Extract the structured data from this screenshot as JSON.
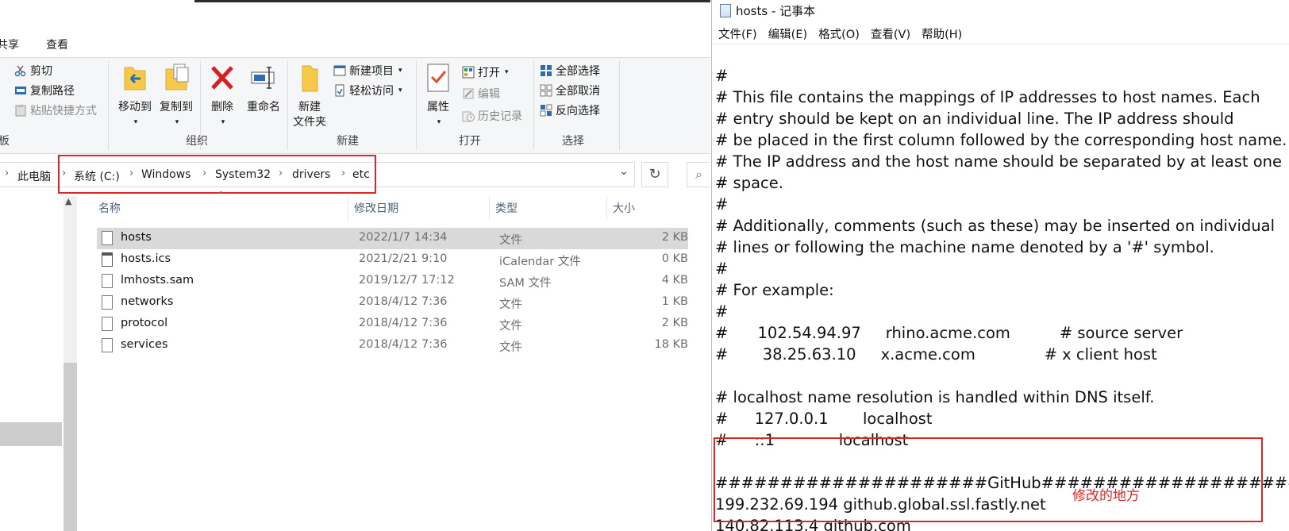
{
  "explorer": {
    "tabs": [
      "共享",
      "查看"
    ],
    "ribbon": {
      "clipboard": {
        "cut": "剪切",
        "copy_path": "复制路径",
        "paste_shortcut": "粘贴快捷方式",
        "group": "板"
      },
      "organize": {
        "move_to": "移动到",
        "copy_to": "复制到",
        "delete": "删除",
        "rename": "重命名",
        "group": "组织"
      },
      "new": {
        "new_folder_line1": "新建",
        "new_folder_line2": "文件夹",
        "new_item": "新建项目",
        "easy_access": "轻松访问",
        "group": "新建"
      },
      "open": {
        "properties": "属性",
        "open": "打开",
        "edit": "编辑",
        "history": "历史记录",
        "group": "打开"
      },
      "select": {
        "select_all": "全部选择",
        "select_none": "全部取消",
        "invert": "反向选择",
        "group": "选择"
      }
    },
    "address": {
      "this_pc": "此电脑",
      "crumbs": [
        "系统 (C:)",
        "Windows",
        "System32",
        "drivers",
        "etc"
      ]
    },
    "columns": {
      "name": "名称",
      "date": "修改日期",
      "type": "类型",
      "size": "大小"
    },
    "files": [
      {
        "name": "hosts",
        "date": "2022/1/7 14:34",
        "type": "文件",
        "size": "2 KB"
      },
      {
        "name": "hosts.ics",
        "date": "2021/2/21 9:10",
        "type": "iCalendar 文件",
        "size": "0 KB"
      },
      {
        "name": "lmhosts.sam",
        "date": "2019/12/7 17:12",
        "type": "SAM 文件",
        "size": "4 KB"
      },
      {
        "name": "networks",
        "date": "2018/4/12 7:36",
        "type": "文件",
        "size": "1 KB"
      },
      {
        "name": "protocol",
        "date": "2018/4/12 7:36",
        "type": "文件",
        "size": "2 KB"
      },
      {
        "name": "services",
        "date": "2018/4/12 7:36",
        "type": "文件",
        "size": "18 KB"
      }
    ]
  },
  "notepad": {
    "title": "hosts - 记事本",
    "menu": [
      "文件(F)",
      "编辑(E)",
      "格式(O)",
      "查看(V)",
      "帮助(H)"
    ],
    "content": "#\n# This file contains the mappings of IP addresses to host names. Each\n# entry should be kept on an individual line. The IP address should\n# be placed in the first column followed by the corresponding host name.\n# The IP address and the host name should be separated by at least one\n# space.\n#\n# Additionally, comments (such as these) may be inserted on individual\n# lines or following the machine name denoted by a '#' symbol.\n#\n# For example:\n#\n#      102.54.94.97     rhino.acme.com          # source server\n#       38.25.63.10     x.acme.com              # x client host\n\n# localhost name resolution is handled within DNS itself.\n#\t127.0.0.1       localhost\n#\t::1             localhost\n\n#####################GitHub#####################\n199.232.69.194 github.global.ssl.fastly.net\n140.82.113.4 github.com",
    "annotation": "修改的地方"
  },
  "colors": {
    "highlight_box": "#e02424",
    "selected_row": "#d9d9d9"
  }
}
